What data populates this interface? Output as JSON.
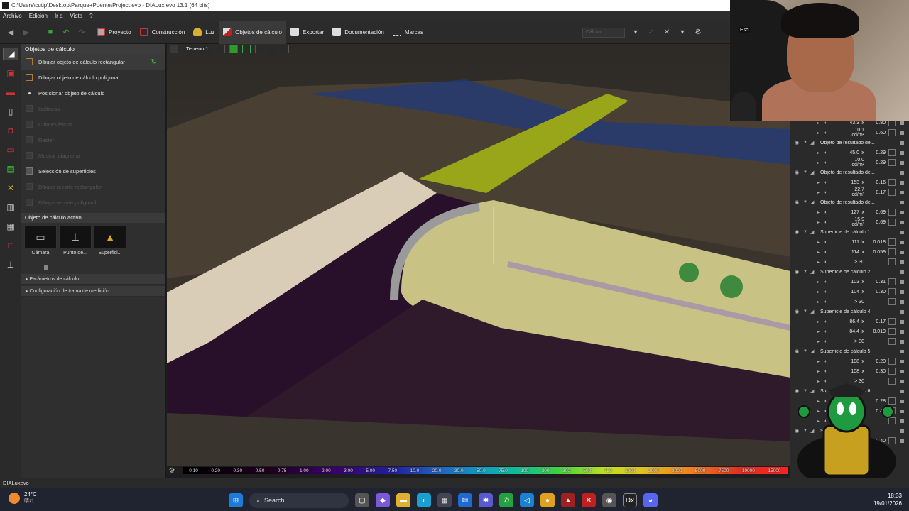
{
  "window": {
    "title": "C:\\Users\\cutip\\Desktop\\Parque+Puente\\Project.evo - DIALux evo 13.1  (64 bits)"
  },
  "menu": [
    "Archivo",
    "Edición",
    "Ir a",
    "Vista",
    "?"
  ],
  "toolbar": {
    "tabs": [
      {
        "label": "Proyecto",
        "color": "#cc3333"
      },
      {
        "label": "Construcción",
        "color": "#cc3333"
      },
      {
        "label": "Luz",
        "color": "#d8b030"
      },
      {
        "label": "Objetos de cálculo",
        "color": "#dddddd"
      },
      {
        "label": "Exportar",
        "color": "#dddddd"
      },
      {
        "label": "Documentación",
        "color": "#dddddd"
      },
      {
        "label": "Marcas",
        "color": "#dddddd"
      }
    ],
    "calc_placeholder": "Cálculo",
    "close": "✕",
    "settings": "⚙"
  },
  "panel": {
    "header": "Objetos de cálculo",
    "items": [
      {
        "label": "Dibujar objeto de cálculo rectangular",
        "enabled": true
      },
      {
        "label": "Dibujar objeto de cálculo poligonal",
        "enabled": true
      },
      {
        "label": "Posicionar objeto de cálculo",
        "enabled": true
      },
      {
        "label": "Isolíneas",
        "enabled": false
      },
      {
        "label": "Colores falsos",
        "enabled": false
      },
      {
        "label": "Raster",
        "enabled": false
      },
      {
        "label": "Mostrar diagrama",
        "enabled": false
      },
      {
        "label": "Selección de superficies",
        "enabled": true
      },
      {
        "label": "Dibujar recorte rectangular",
        "enabled": false
      },
      {
        "label": "Dibujar recorte poligonal",
        "enabled": false
      }
    ],
    "active_title": "Objeto de cálculo activo",
    "objects": [
      {
        "label": "Cámara"
      },
      {
        "label": "Punto de..."
      },
      {
        "label": "Superfici..."
      }
    ],
    "sections": [
      "Parámetros de cálculo",
      "Configuración de trama de medición"
    ]
  },
  "viewport": {
    "terrain_label": "Terreno 1"
  },
  "scale": [
    "0.10",
    "0.20",
    "0.30",
    "0.50",
    "0.75",
    "1.00",
    "2.00",
    "3.00",
    "5.00",
    "7.50",
    "10.0",
    "20.0",
    "30.0",
    "50.0",
    "75.0",
    "100",
    "200",
    "300",
    "500",
    "750",
    "1000",
    "2000",
    "3000",
    "5000",
    "7500",
    "10000",
    "15000"
  ],
  "results": [
    {
      "kind": "val",
      "v1": "43.3 lx",
      "v2": "0.80"
    },
    {
      "kind": "val",
      "v1": "10.1 cd/m²",
      "v2": "0.60"
    },
    {
      "kind": "group",
      "name": "Objeto de resultado de..."
    },
    {
      "kind": "val",
      "v1": "45.0 lx",
      "v2": "0.29"
    },
    {
      "kind": "val",
      "v1": "10.0 cd/m²",
      "v2": "0.29"
    },
    {
      "kind": "group",
      "name": "Objeto de resultado de..."
    },
    {
      "kind": "val",
      "v1": "153 lx",
      "v2": "0.16"
    },
    {
      "kind": "val",
      "v1": "22.7 cd/m²",
      "v2": "0.17"
    },
    {
      "kind": "group",
      "name": "Objeto de resultado de..."
    },
    {
      "kind": "val",
      "v1": "127 lx",
      "v2": "0.69"
    },
    {
      "kind": "val",
      "v1": "15.9 cd/m²",
      "v2": "0.69"
    },
    {
      "kind": "group",
      "name": "Superficie de cálculo 1"
    },
    {
      "kind": "val",
      "v1": "111 lx",
      "v2": "0.018"
    },
    {
      "kind": "val",
      "v1": "114 lx",
      "v2": "0.059"
    },
    {
      "kind": "val",
      "v1": "> 30",
      "v2": ""
    },
    {
      "kind": "group",
      "name": "Superficie de cálculo 2"
    },
    {
      "kind": "val",
      "v1": "103 lx",
      "v2": "0.31"
    },
    {
      "kind": "val",
      "v1": "104 lx",
      "v2": "0.30"
    },
    {
      "kind": "val",
      "v1": "> 30",
      "v2": ""
    },
    {
      "kind": "group",
      "name": "Superficie de cálculo 4"
    },
    {
      "kind": "val",
      "v1": "86.4 lx",
      "v2": "0.17"
    },
    {
      "kind": "val",
      "v1": "84.4 lx",
      "v2": "0.019"
    },
    {
      "kind": "val",
      "v1": "> 30",
      "v2": ""
    },
    {
      "kind": "group",
      "name": "Superficie de cálculo 5"
    },
    {
      "kind": "val",
      "v1": "108 lx",
      "v2": "0.20"
    },
    {
      "kind": "val",
      "v1": "108 lx",
      "v2": "0.30"
    },
    {
      "kind": "val",
      "v1": "> 30",
      "v2": ""
    },
    {
      "kind": "group",
      "name": "Superficie de cálculo 6"
    },
    {
      "kind": "val",
      "v1": "",
      "v2": "0.28"
    },
    {
      "kind": "val",
      "v1": "",
      "v2": "0.41"
    },
    {
      "kind": "val",
      "v1": "",
      "v2": ""
    },
    {
      "kind": "group",
      "name": "Superficie de cálculo 7"
    },
    {
      "kind": "val",
      "v1": "",
      "v2": "0.40"
    }
  ],
  "webcam": {
    "chair_label": "Esc"
  },
  "statusbar": "DIALuxevo",
  "taskbar": {
    "temp": "24°C",
    "condition": "晴れ",
    "search": "Search",
    "time": "18:33",
    "date": "19/01/2026"
  }
}
